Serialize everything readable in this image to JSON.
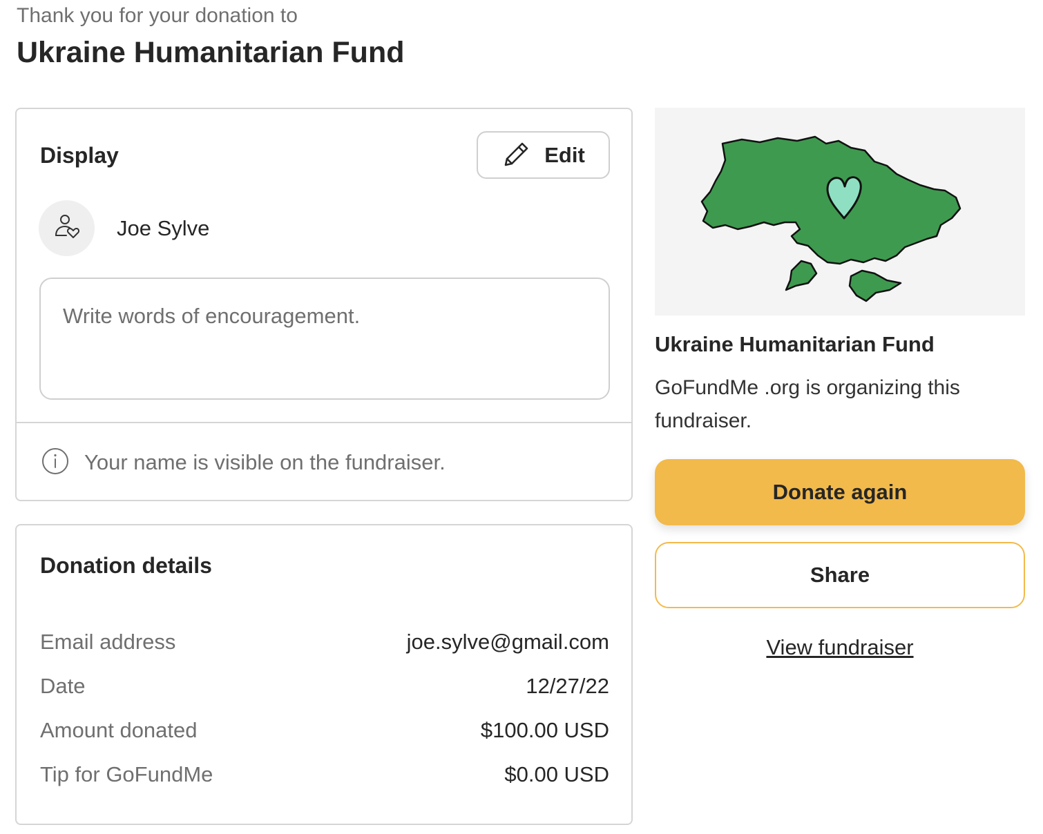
{
  "header": {
    "subtitle": "Thank you for your donation to",
    "title": "Ukraine Humanitarian Fund"
  },
  "display_card": {
    "title": "Display",
    "edit_label": "Edit",
    "edit_icon": "pencil-icon",
    "avatar_icon": "person-heart-icon",
    "donor_name": "Joe Sylve",
    "comment_placeholder": "Write words of encouragement.",
    "comment_value": "",
    "info_icon": "info-icon",
    "visibility_note": "Your name is visible on the fundraiser."
  },
  "donation_details": {
    "title": "Donation details",
    "rows": [
      {
        "label": "Email address",
        "value": "joe.sylve@gmail.com"
      },
      {
        "label": "Date",
        "value": "12/27/22"
      },
      {
        "label": "Amount donated",
        "value": "$100.00 USD"
      },
      {
        "label": "Tip for GoFundMe",
        "value": "$0.00 USD"
      }
    ]
  },
  "campaign": {
    "image": "ukraine-map-heart-illustration",
    "name": "Ukraine Humanitarian Fund",
    "organizer_text": "GoFundMe .org is organizing this fundraiser.",
    "donate_again_label": "Donate again",
    "share_label": "Share",
    "view_link_label": "View fundraiser"
  },
  "colors": {
    "accent": "#f2ba4b",
    "map_green": "#3e9a4f",
    "heart": "#8fe0c2",
    "text_primary": "#262626",
    "text_secondary": "#6f6f6f",
    "border": "#d5d5d5"
  }
}
